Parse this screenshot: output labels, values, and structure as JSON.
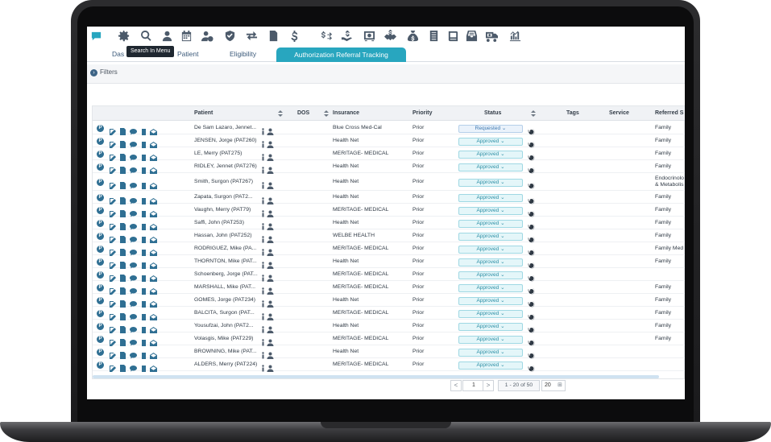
{
  "toolbar": {
    "icons": [
      "chat-icon",
      "gear-icon",
      "search-icon",
      "user-icon",
      "calendar-icon",
      "user-settings-icon",
      "shield-icon",
      "transfer-icon",
      "document-icon",
      "dollar-icon",
      "dollar-transfer-icon",
      "hand-money-icon",
      "safe-icon",
      "handshake-dollar-icon",
      "money-bag-icon",
      "ledger-icon",
      "book-icon",
      "inbox-icon",
      "truck-money-icon",
      "bar-chart-icon"
    ],
    "tooltip": "Search In Menu"
  },
  "tabs": {
    "dashboard": "Das",
    "patient": "Patient",
    "eligibility": "Eligibility",
    "active": "Authorization Referral Tracking"
  },
  "filters": {
    "label": "Filters"
  },
  "table": {
    "headers": {
      "patient": "Patient",
      "dos": "DOS",
      "insurance": "Insurance",
      "priority": "Priority",
      "status": "Status",
      "tags": "Tags",
      "service": "Service",
      "referred": "Referred S"
    },
    "rows": [
      {
        "patient": "De Sam Lazaro, Jennet...",
        "insurance": "Blue Cross Med-Cal",
        "priority": "Prior",
        "status": "Requested",
        "referred": "Family"
      },
      {
        "patient": "JENSEN, Jorge (PAT260)",
        "insurance": "Health Net",
        "priority": "Prior",
        "status": "Approved",
        "referred": "Family"
      },
      {
        "patient": "LE, Merry (PAT275)",
        "insurance": "MERITAGE- MEDICAL",
        "priority": "Prior",
        "status": "Approved",
        "referred": "Family"
      },
      {
        "patient": "RIDLEY, Jennet (PAT276)",
        "insurance": "Health Net",
        "priority": "Prior",
        "status": "Approved",
        "referred": "Family"
      },
      {
        "patient": "Smith, Surgon (PAT267)",
        "insurance": "Health Net",
        "priority": "Prior",
        "status": "Approved",
        "referred": "Endocrinolo\n& Metabolis"
      },
      {
        "patient": "Zapata, Surgon (PAT2...",
        "insurance": "Health Net",
        "priority": "Prior",
        "status": "Approved",
        "referred": "Family"
      },
      {
        "patient": "Vaughn, Merry (PAT79)",
        "insurance": "MERITAGE- MEDICAL",
        "priority": "Prior",
        "status": "Approved",
        "referred": "Family"
      },
      {
        "patient": "Saffi, John (PAT253)",
        "insurance": "Health Net",
        "priority": "Prior",
        "status": "Approved",
        "referred": "Family"
      },
      {
        "patient": "Hassan, John (PAT252)",
        "insurance": "WELBE HEALTH",
        "priority": "Prior",
        "status": "Approved",
        "referred": "Family"
      },
      {
        "patient": "RODRIGUEZ, Mike (PA...",
        "insurance": "MERITAGE- MEDICAL",
        "priority": "Prior",
        "status": "Approved",
        "referred": "Family Med"
      },
      {
        "patient": "THORNTON, Mike (PAT...",
        "insurance": "Health Net",
        "priority": "Prior",
        "status": "Approved",
        "referred": "Family"
      },
      {
        "patient": "Schoenberg, Jorge (PAT...",
        "insurance": "MERITAGE- MEDICAL",
        "priority": "Prior",
        "status": "Approved",
        "referred": ""
      },
      {
        "patient": "MARSHALL, Mike (PAT...",
        "insurance": "MERITAGE- MEDICAL",
        "priority": "Prior",
        "status": "Approved",
        "referred": "Family"
      },
      {
        "patient": "GOMES, Jorge (PAT234)",
        "insurance": "Health Net",
        "priority": "Prior",
        "status": "Approved",
        "referred": "Family"
      },
      {
        "patient": "BALCITA, Surgon (PAT...",
        "insurance": "MERITAGE- MEDICAL",
        "priority": "Prior",
        "status": "Approved",
        "referred": "Family"
      },
      {
        "patient": "Yousufzai, John (PAT2...",
        "insurance": "Health Net",
        "priority": "Prior",
        "status": "Approved",
        "referred": "Family"
      },
      {
        "patient": "Volasgis, Mike (PAT229)",
        "insurance": "MERITAGE- MEDICAL",
        "priority": "Prior",
        "status": "Approved",
        "referred": "Family"
      },
      {
        "patient": "BROWNING, Mike (PAT...",
        "insurance": "Health Net",
        "priority": "Prior",
        "status": "Approved",
        "referred": ""
      },
      {
        "patient": "ALDERS, Merry (PAT224)",
        "insurance": "MERITAGE- MEDICAL",
        "priority": "Prior",
        "status": "Approved",
        "referred": ""
      }
    ]
  },
  "pagination": {
    "prev": "<",
    "page": "1",
    "next": ">",
    "info": "1 - 20 of 50",
    "page_size": "20"
  },
  "colors": {
    "accent": "#28a6bf",
    "icon": "#4c5a6a",
    "action_icon": "#2f6f93",
    "status_bg": "#e4f6f9",
    "status_text": "#2b8ea5"
  }
}
